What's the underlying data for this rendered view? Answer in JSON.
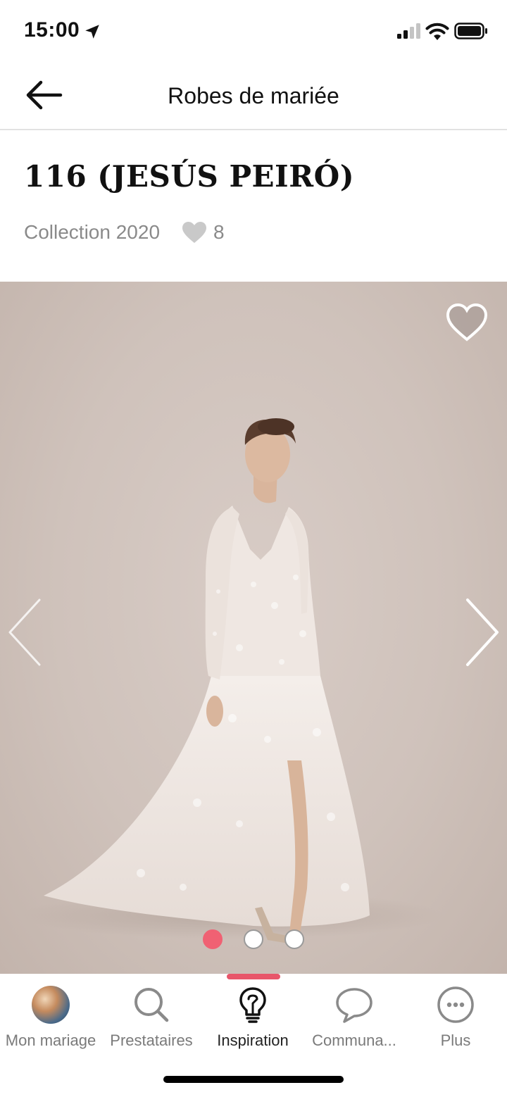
{
  "status_bar": {
    "time": "15:00"
  },
  "nav": {
    "title": "Robes de mariée"
  },
  "dress": {
    "name": "116 (JESÚS PEIRÓ)",
    "collection": "Collection 2020",
    "likes": "8"
  },
  "gallery": {
    "total_images": 3,
    "current_index": 1
  },
  "tabs": [
    {
      "label": "Mon mariage",
      "icon": "avatar"
    },
    {
      "label": "Prestataires",
      "icon": "search-icon"
    },
    {
      "label": "Inspiration",
      "icon": "lightbulb-icon",
      "active": true
    },
    {
      "label": "Communa...",
      "icon": "chat-bubble-icon"
    },
    {
      "label": "Plus",
      "icon": "more-dots-icon"
    }
  ],
  "colors": {
    "accent": "#f06173",
    "indicator": "#e8566a",
    "muted_text": "#8a8a8a"
  }
}
